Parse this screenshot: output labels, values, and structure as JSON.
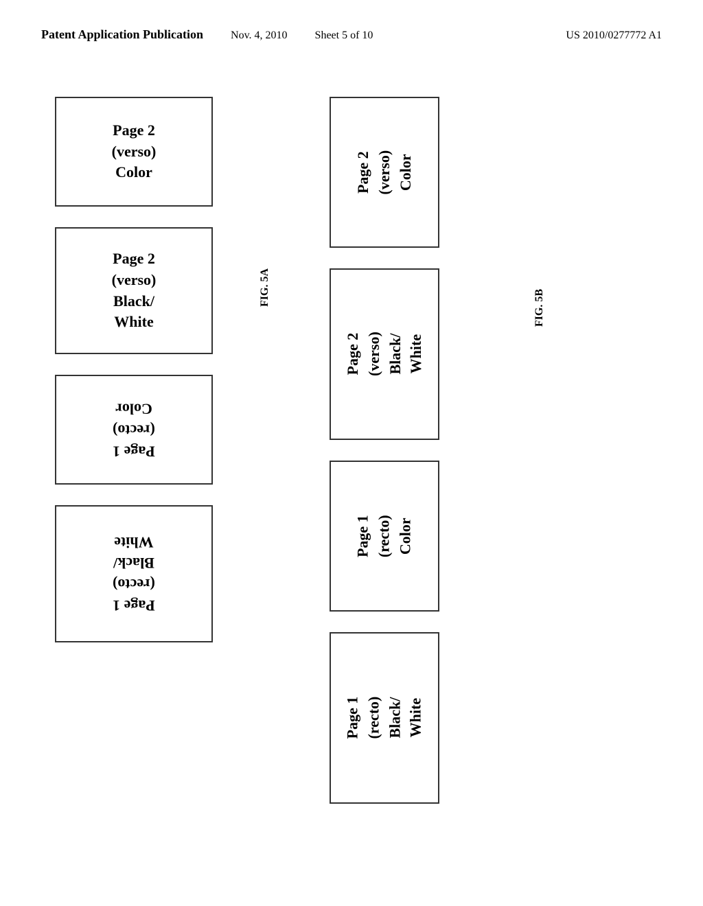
{
  "header": {
    "title": "Patent Application Publication",
    "date": "Nov. 4, 2010",
    "sheet": "Sheet 5 of 10",
    "patent": "US 2010/0277772 A1"
  },
  "figures": {
    "fig5a_label": "FIG. 5A",
    "fig5b_label": "FIG. 5B"
  },
  "left_boxes": [
    {
      "id": "left-box-1",
      "lines": [
        "Page 2",
        "(verso)",
        "Color"
      ],
      "upside_down": false
    },
    {
      "id": "left-box-2",
      "lines": [
        "Page 2",
        "(verso)",
        "Black/",
        "White"
      ],
      "upside_down": false
    },
    {
      "id": "left-box-3",
      "lines": [
        "Page 1",
        "(recto)",
        "Color"
      ],
      "upside_down": true
    },
    {
      "id": "left-box-4",
      "lines": [
        "Page 1",
        "(recto)",
        "Black/",
        "White"
      ],
      "upside_down": true
    }
  ],
  "right_boxes": [
    {
      "id": "right-box-1",
      "lines": [
        "Page 2",
        "(verso)",
        "Color"
      ],
      "rotated": true
    },
    {
      "id": "right-box-2",
      "lines": [
        "Page 2",
        "(verso)",
        "Black/",
        "White"
      ],
      "rotated": true
    },
    {
      "id": "right-box-3",
      "lines": [
        "Page 1",
        "(recto)",
        "Color"
      ],
      "rotated": false
    },
    {
      "id": "right-box-4",
      "lines": [
        "Page 1",
        "(recto)",
        "Black/",
        "White"
      ],
      "rotated": false
    }
  ]
}
